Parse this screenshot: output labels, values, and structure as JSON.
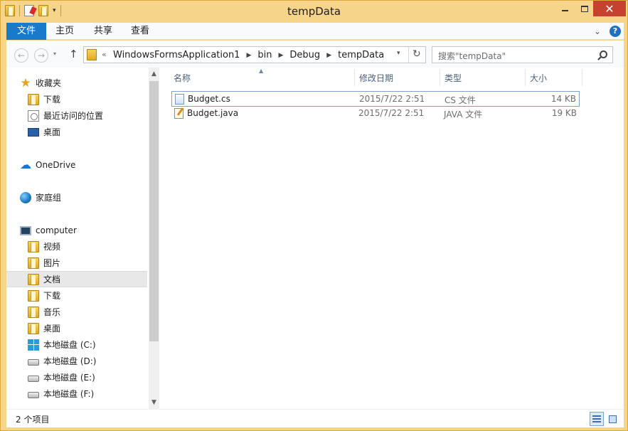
{
  "window": {
    "title": "tempData"
  },
  "quick_access_toolbar": {
    "icons": [
      "folder-icon",
      "properties-icon",
      "new-folder-icon",
      "customize-dropdown-icon"
    ]
  },
  "ribbon": {
    "tabs": [
      "文件",
      "主页",
      "共享",
      "查看"
    ]
  },
  "navigation": {
    "back_glyph": "←",
    "forward_glyph": "→",
    "up_glyph": "↑",
    "overflow": "«",
    "breadcrumbs": [
      "WindowsFormsApplication1",
      "bin",
      "Debug",
      "tempData"
    ],
    "refresh_glyph": "↻",
    "search_placeholder": "搜索\"tempData\""
  },
  "sidebar": {
    "favorites": {
      "label": "收藏夹",
      "items": [
        "下载",
        "最近访问的位置",
        "桌面"
      ]
    },
    "onedrive": "OneDrive",
    "homegroup": "家庭组",
    "computer": {
      "label": "computer",
      "items": [
        "视频",
        "图片",
        "文档",
        "下载",
        "音乐",
        "桌面",
        "本地磁盘 (C:)",
        "本地磁盘 (D:)",
        "本地磁盘 (E:)",
        "本地磁盘 (F:)"
      ],
      "selected": "文档"
    }
  },
  "file_list": {
    "columns": [
      "名称",
      "修改日期",
      "类型",
      "大小"
    ],
    "rows": [
      {
        "name": "Budget.cs",
        "modified": "2015/7/22 2:51",
        "type": "CS 文件",
        "size": "14 KB"
      },
      {
        "name": "Budget.java",
        "modified": "2015/7/22 2:51",
        "type": "JAVA 文件",
        "size": "19 KB"
      }
    ]
  },
  "status_bar": {
    "item_count": "2 个项目"
  },
  "colors": {
    "frame": "#f6d58a",
    "file_tab": "#1979ca",
    "close_button": "#c7412f",
    "selection_border": "#7da2ce"
  }
}
